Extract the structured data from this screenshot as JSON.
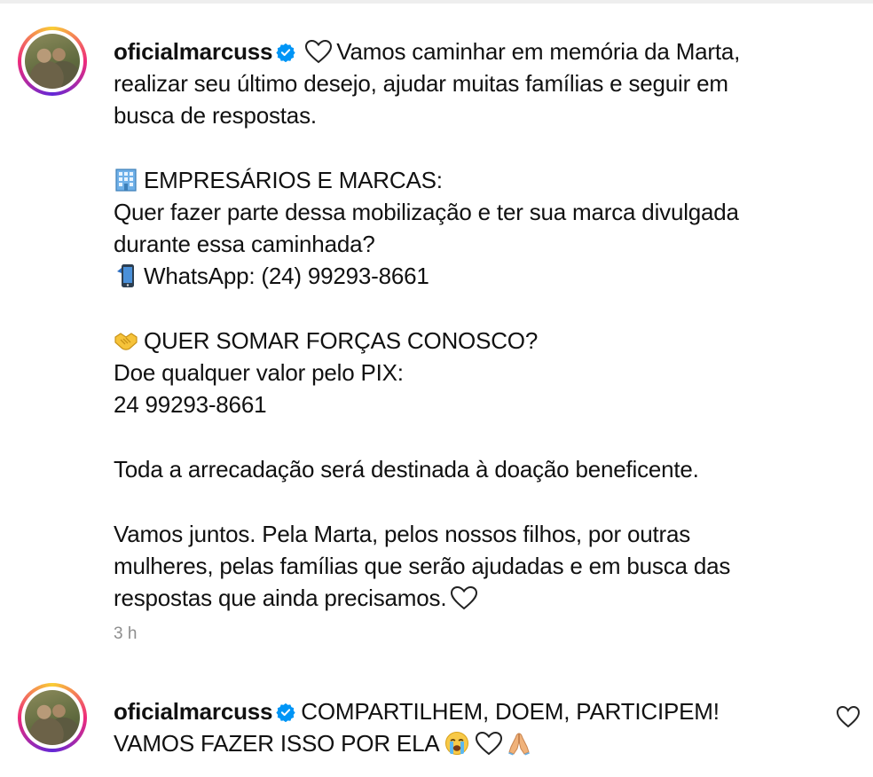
{
  "comments": [
    {
      "username": "oficialmarcuss",
      "verified": true,
      "lines": {
        "l1": "Vamos caminhar em memória da Marta,",
        "l2": "realizar seu último desejo, ajudar muitas famílias e seguir em",
        "l3": "busca de respostas.",
        "l4": "EMPRESÁRIOS E MARCAS:",
        "l5": "Quer fazer parte dessa mobilização e ter sua marca divulgada",
        "l6": "durante essa caminhada?",
        "l7": "WhatsApp: (24) 99293-8661",
        "l8": "QUER SOMAR FORÇAS CONOSCO?",
        "l9": "Doe qualquer valor pelo PIX:",
        "l10": "24 99293-8661",
        "l11": "Toda a arrecadação será destinada à doação beneficente.",
        "l12": "Vamos juntos. Pela Marta, pelos nossos filhos, por outras",
        "l13": "mulheres, pelas famílias que serão ajudadas e em busca das",
        "l14": "respostas que ainda precisamos."
      },
      "timestamp": "3 h",
      "icons": [
        "verified-icon",
        "heart-icon",
        "office-building-icon",
        "mobile-phone-icon",
        "handshake-icon",
        "heart-icon"
      ]
    },
    {
      "username": "oficialmarcuss",
      "verified": true,
      "lines": {
        "l1": "COMPARTILHEM, DOEM, PARTICIPEM!",
        "l2": "VAMOS FAZER ISSO POR ELA"
      },
      "icons": [
        "verified-icon",
        "crying-face-icon",
        "heart-icon",
        "praying-hands-icon",
        "like-heart-icon"
      ]
    }
  ],
  "colors": {
    "verified_blue": "#0095f6",
    "timestamp_gray": "#8e8e8e",
    "text": "#111111"
  }
}
